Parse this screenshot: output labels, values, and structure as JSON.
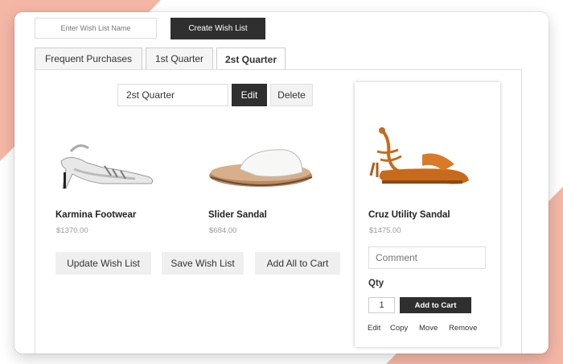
{
  "create_form": {
    "name_placeholder": "Enter Wish List Name",
    "create_label": "Create Wish List"
  },
  "tabs": [
    {
      "label": "Frequent  Purchases",
      "active": false
    },
    {
      "label": "1st Quarter",
      "active": false
    },
    {
      "label": "2st Quarter",
      "active": true
    }
  ],
  "list_editor": {
    "name_value": "2st Quarter",
    "edit_label": "Edit",
    "delete_label": "Delete"
  },
  "products": [
    {
      "name": "Karmina Footwear",
      "price": "$1370.00",
      "icon": "heeled-sandal-icon"
    },
    {
      "name": "Slider Sandal",
      "price": "$684.00",
      "icon": "slide-sandal-icon"
    }
  ],
  "actions": {
    "update_label": "Update Wish List",
    "save_label": "Save Wish List",
    "add_all_label": "Add All to Cart"
  },
  "selected_product": {
    "name": "Cruz Utility Sandal",
    "price": "$1475.00",
    "icon": "tie-up-sandal-icon",
    "comment_placeholder": "Comment",
    "qty_label": "Qty",
    "qty_value": "1",
    "add_to_cart_label": "Add to Cart",
    "links": {
      "edit": "Edit",
      "copy": "Copy",
      "move": "Move",
      "remove": "Remove"
    }
  },
  "colors": {
    "accent_bg": "#f4b7a6",
    "dark_button": "#2f2f2f",
    "light_button": "#efefef"
  }
}
